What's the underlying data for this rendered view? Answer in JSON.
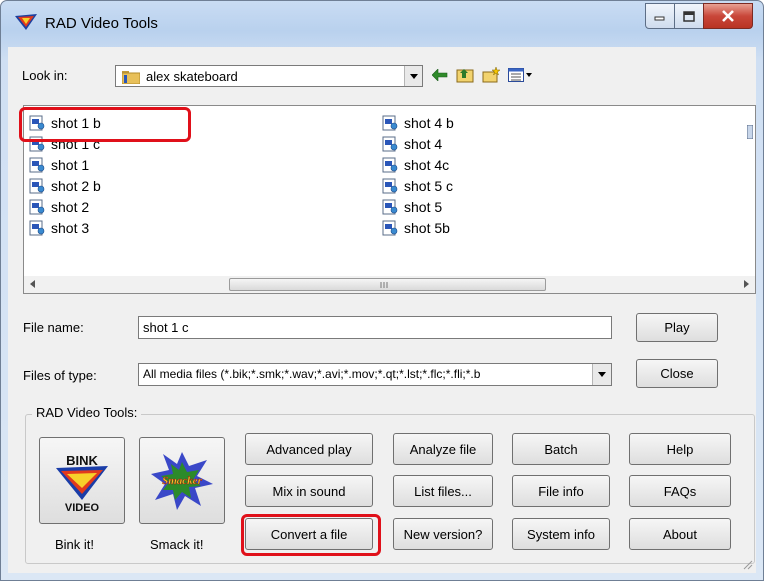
{
  "window": {
    "title": "RAD Video Tools",
    "caption_buttons": [
      "minimize",
      "maximize",
      "close"
    ]
  },
  "lookin": {
    "label": "Look in:",
    "value": "alex skateboard",
    "toolbar_icons": [
      "back-arrow-icon",
      "up-folder-icon",
      "new-folder-icon",
      "view-menu-icon"
    ]
  },
  "files": {
    "col1": [
      "shot 1 b",
      "shot 1 c",
      "shot 1",
      "shot 2 b",
      "shot 2",
      "shot 3"
    ],
    "col2": [
      "shot 4 b",
      "shot 4",
      "shot 4c",
      "shot 5 c",
      "shot 5",
      "shot 5b"
    ],
    "highlighted": "shot 1 b"
  },
  "filename": {
    "label": "File name:",
    "value": "shot 1 c"
  },
  "filetype": {
    "label": "Files of type:",
    "value": "All media files (*.bik;*.smk;*.wav;*.avi;*.mov;*.qt;*.lst;*.flc;*.fli;*.b"
  },
  "side_buttons": {
    "play": "Play",
    "close": "Close"
  },
  "group": {
    "title": "RAD Video Tools:",
    "bink_label": "Bink it!",
    "smack_label": "Smack it!",
    "bink_logo_lines": [
      "BINK",
      "VIDEO"
    ],
    "smack_logo_text": "Smacker"
  },
  "buttons": {
    "advanced_play": "Advanced play",
    "analyze_file": "Analyze file",
    "batch": "Batch",
    "help": "Help",
    "mix_in_sound": "Mix in sound",
    "list_files": "List files...",
    "file_info": "File info",
    "faqs": "FAQs",
    "convert_file": "Convert a file",
    "new_version": "New version?",
    "system_info": "System info",
    "about": "About"
  },
  "colors": {
    "highlight": "#e0101a",
    "title_gradient": "#c9dcf3",
    "client_bg": "#f0f0f0"
  }
}
